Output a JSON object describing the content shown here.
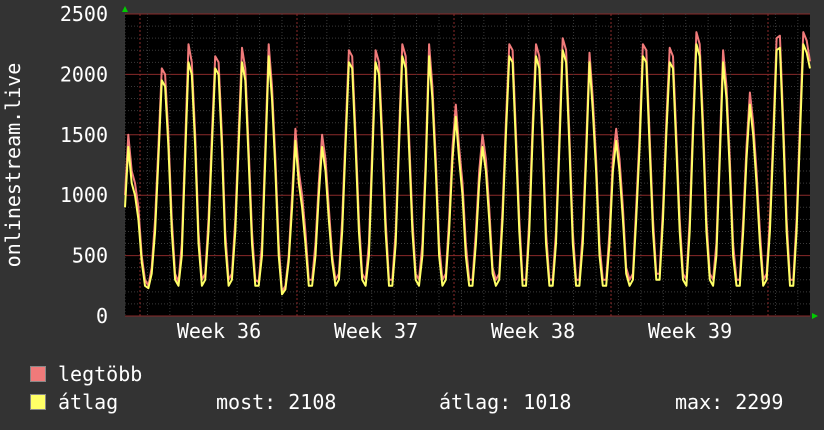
{
  "chart_data": {
    "type": "line",
    "ylabel": "onlinestream.live",
    "ylim": [
      0,
      2500
    ],
    "yticks": [
      0,
      500,
      1000,
      1500,
      2000,
      2500
    ],
    "xticks": [
      "Week 36",
      "Week 37",
      "Week 38",
      "Week 39"
    ],
    "grid": true,
    "colors": {
      "max": "#f07a7a",
      "avg": "#ffff66",
      "background": "#000000",
      "panel": "#333333"
    },
    "series": [
      {
        "name": "legtöbb",
        "values": [
          1000,
          1500,
          1200,
          1100,
          900,
          500,
          300,
          250,
          400,
          800,
          1400,
          2050,
          2000,
          1500,
          800,
          350,
          280,
          600,
          1400,
          2250,
          2100,
          1500,
          700,
          300,
          350,
          800,
          1500,
          2150,
          2100,
          1500,
          700,
          300,
          350,
          800,
          1500,
          2220,
          2050,
          1400,
          700,
          300,
          280,
          600,
          1400,
          2250,
          1900,
          1300,
          600,
          200,
          250,
          500,
          1000,
          1550,
          1200,
          1000,
          700,
          300,
          300,
          600,
          1100,
          1500,
          1300,
          900,
          500,
          300,
          350,
          800,
          1500,
          2200,
          2150,
          1500,
          800,
          350,
          300,
          600,
          1400,
          2200,
          2100,
          1500,
          800,
          300,
          300,
          700,
          1500,
          2250,
          2150,
          1500,
          800,
          350,
          300,
          600,
          1300,
          2250,
          1900,
          1300,
          600,
          300,
          350,
          800,
          1400,
          1750,
          1400,
          1100,
          600,
          300,
          300,
          700,
          1200,
          1500,
          1300,
          900,
          400,
          300,
          350,
          900,
          1600,
          2250,
          2200,
          1500,
          800,
          300,
          300,
          800,
          1600,
          2250,
          2150,
          1500,
          700,
          300,
          300,
          700,
          1500,
          2300,
          2200,
          1500,
          700,
          300,
          300,
          700,
          1400,
          2180,
          1800,
          1300,
          600,
          300,
          300,
          700,
          1300,
          1550,
          1300,
          900,
          400,
          300,
          350,
          900,
          1500,
          2250,
          2200,
          1500,
          800,
          350,
          350,
          900,
          1600,
          2220,
          2150,
          1500,
          800,
          350,
          300,
          800,
          1600,
          2350,
          2250,
          1600,
          800,
          350,
          300,
          600,
          1400,
          2200,
          1900,
          1300,
          600,
          300,
          300,
          800,
          1400,
          1850,
          1600,
          1200,
          700,
          300,
          350,
          800,
          1500,
          2300,
          2320,
          1600,
          800,
          300,
          300,
          800,
          1600,
          2350,
          2280,
          2108
        ],
        "stroke": "#f07a7a"
      },
      {
        "name": "átlag",
        "values": [
          900,
          1400,
          1100,
          1000,
          800,
          450,
          250,
          230,
          350,
          700,
          1300,
          1950,
          1900,
          1400,
          700,
          300,
          250,
          500,
          1300,
          2100,
          2000,
          1400,
          600,
          250,
          300,
          700,
          1400,
          2050,
          2000,
          1400,
          600,
          250,
          300,
          700,
          1400,
          2100,
          1950,
          1300,
          600,
          250,
          250,
          500,
          1300,
          2150,
          1800,
          1200,
          500,
          180,
          220,
          450,
          900,
          1450,
          1100,
          900,
          600,
          250,
          250,
          500,
          1000,
          1400,
          1200,
          800,
          450,
          250,
          300,
          700,
          1400,
          2100,
          2050,
          1400,
          700,
          300,
          250,
          500,
          1300,
          2100,
          2000,
          1400,
          700,
          250,
          250,
          600,
          1400,
          2150,
          2050,
          1400,
          700,
          300,
          250,
          500,
          1200,
          2150,
          1800,
          1200,
          500,
          250,
          300,
          700,
          1300,
          1650,
          1300,
          1000,
          500,
          250,
          250,
          600,
          1100,
          1400,
          1200,
          800,
          350,
          250,
          300,
          800,
          1500,
          2150,
          2100,
          1400,
          700,
          250,
          250,
          700,
          1500,
          2150,
          2050,
          1400,
          600,
          250,
          250,
          600,
          1400,
          2200,
          2100,
          1400,
          600,
          250,
          250,
          600,
          1300,
          2100,
          1700,
          1200,
          500,
          250,
          250,
          600,
          1200,
          1450,
          1200,
          800,
          350,
          250,
          300,
          800,
          1400,
          2150,
          2100,
          1400,
          700,
          300,
          300,
          800,
          1500,
          2100,
          2050,
          1400,
          700,
          300,
          250,
          700,
          1500,
          2250,
          2150,
          1500,
          700,
          300,
          250,
          500,
          1300,
          2100,
          1800,
          1200,
          500,
          250,
          250,
          700,
          1300,
          1750,
          1500,
          1100,
          600,
          250,
          300,
          700,
          1400,
          2200,
          2220,
          1500,
          700,
          250,
          250,
          700,
          1500,
          2250,
          2180,
          2050
        ],
        "stroke": "#ffff66"
      }
    ],
    "stats": {
      "now_label": "most:",
      "now_value": "2108",
      "avg_label": "átlag:",
      "avg_value": "1018",
      "max_label": "max:",
      "max_value": "2299"
    }
  }
}
